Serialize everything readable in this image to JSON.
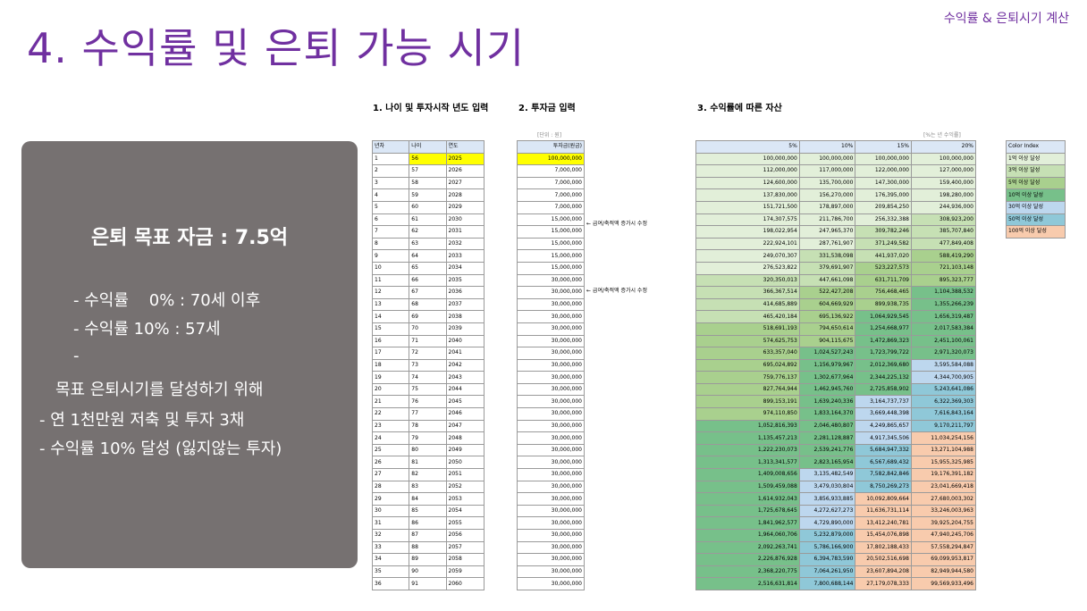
{
  "header": {
    "title": "4. 수익률 및 은퇴 가능 시기",
    "corner": "수익률 & 은퇴시기 계산"
  },
  "sections": {
    "s1": "1. 나이 및 투자시작 년도 입력",
    "s2": "2. 투자금 입력",
    "s3": "3. 수익률에 따른 자산"
  },
  "units": {
    "won": "[단위 : 원]",
    "rate": "[%는 년 수익률]"
  },
  "summary": {
    "goal": "은퇴 목표 자금 : 7.5억",
    "line1": "- 수익률    0% : 70세 이후",
    "line2": "- 수익률 10% : 57세",
    "line3": "-",
    "line4": "목표 은퇴시기를 달성하기 위해",
    "line5": "- 연 1천만원 저축 및 투자 3채",
    "line6": "- 수익률 10% 달성 (잃지않는 투자)"
  },
  "notes": {
    "n1": "← 급여/축적액 증가시 수정",
    "n2": "← 급여/축적액 증가시 수정"
  },
  "colors": {
    "accent": "#7030a0",
    "panel": "#767171",
    "start_highlight": "#ffff00",
    "tier1": "#e2efd9",
    "tier3": "#c6e0b4",
    "tier5": "#a9d08e",
    "tier10": "#77c08a",
    "tier30": "#bdd7ee",
    "tier50": "#8fc8d8",
    "tier100": "#f8cbad"
  },
  "table1": {
    "headers": [
      "년차",
      "나이",
      "연도"
    ],
    "rows": [
      [
        "1",
        "56",
        "2025"
      ],
      [
        "2",
        "57",
        "2026"
      ],
      [
        "3",
        "58",
        "2027"
      ],
      [
        "4",
        "59",
        "2028"
      ],
      [
        "5",
        "60",
        "2029"
      ],
      [
        "6",
        "61",
        "2030"
      ],
      [
        "7",
        "62",
        "2031"
      ],
      [
        "8",
        "63",
        "2032"
      ],
      [
        "9",
        "64",
        "2033"
      ],
      [
        "10",
        "65",
        "2034"
      ],
      [
        "11",
        "66",
        "2035"
      ],
      [
        "12",
        "67",
        "2036"
      ],
      [
        "13",
        "68",
        "2037"
      ],
      [
        "14",
        "69",
        "2038"
      ],
      [
        "15",
        "70",
        "2039"
      ],
      [
        "16",
        "71",
        "2040"
      ],
      [
        "17",
        "72",
        "2041"
      ],
      [
        "18",
        "73",
        "2042"
      ],
      [
        "19",
        "74",
        "2043"
      ],
      [
        "20",
        "75",
        "2044"
      ],
      [
        "21",
        "76",
        "2045"
      ],
      [
        "22",
        "77",
        "2046"
      ],
      [
        "23",
        "78",
        "2047"
      ],
      [
        "24",
        "79",
        "2048"
      ],
      [
        "25",
        "80",
        "2049"
      ],
      [
        "26",
        "81",
        "2050"
      ],
      [
        "27",
        "82",
        "2051"
      ],
      [
        "28",
        "83",
        "2052"
      ],
      [
        "29",
        "84",
        "2053"
      ],
      [
        "30",
        "85",
        "2054"
      ],
      [
        "31",
        "86",
        "2055"
      ],
      [
        "32",
        "87",
        "2056"
      ],
      [
        "33",
        "88",
        "2057"
      ],
      [
        "34",
        "89",
        "2058"
      ],
      [
        "35",
        "90",
        "2059"
      ],
      [
        "36",
        "91",
        "2060"
      ]
    ]
  },
  "table2": {
    "header": "투자금(원금)",
    "rows": [
      "100,000,000",
      "7,000,000",
      "7,000,000",
      "7,000,000",
      "7,000,000",
      "15,000,000",
      "15,000,000",
      "15,000,000",
      "15,000,000",
      "15,000,000",
      "30,000,000",
      "30,000,000",
      "30,000,000",
      "30,000,000",
      "30,000,000",
      "30,000,000",
      "30,000,000",
      "30,000,000",
      "30,000,000",
      "30,000,000",
      "30,000,000",
      "30,000,000",
      "30,000,000",
      "30,000,000",
      "30,000,000",
      "30,000,000",
      "30,000,000",
      "30,000,000",
      "30,000,000",
      "30,000,000",
      "30,000,000",
      "30,000,000",
      "30,000,000",
      "30,000,000",
      "30,000,000",
      "30,000,000"
    ]
  },
  "table3": {
    "headers": [
      "5%",
      "10%",
      "15%",
      "20%"
    ],
    "rows": [
      [
        "100,000,000",
        "100,000,000",
        "100,000,000",
        "100,000,000"
      ],
      [
        "112,000,000",
        "117,000,000",
        "122,000,000",
        "127,000,000"
      ],
      [
        "124,600,000",
        "135,700,000",
        "147,300,000",
        "159,400,000"
      ],
      [
        "137,830,000",
        "156,270,000",
        "176,395,000",
        "198,280,000"
      ],
      [
        "151,721,500",
        "178,897,000",
        "209,854,250",
        "244,936,000"
      ],
      [
        "174,307,575",
        "211,786,700",
        "256,332,388",
        "308,923,200"
      ],
      [
        "198,022,954",
        "247,965,370",
        "309,782,246",
        "385,707,840"
      ],
      [
        "222,924,101",
        "287,761,907",
        "371,249,582",
        "477,849,408"
      ],
      [
        "249,070,307",
        "331,538,098",
        "441,937,020",
        "588,419,290"
      ],
      [
        "276,523,822",
        "379,691,907",
        "523,227,573",
        "721,103,148"
      ],
      [
        "320,350,013",
        "447,661,098",
        "631,711,709",
        "895,323,777"
      ],
      [
        "366,367,514",
        "522,427,208",
        "756,468,465",
        "1,104,388,532"
      ],
      [
        "414,685,889",
        "604,669,929",
        "899,938,735",
        "1,355,266,239"
      ],
      [
        "465,420,184",
        "695,136,922",
        "1,064,929,545",
        "1,656,319,487"
      ],
      [
        "518,691,193",
        "794,650,614",
        "1,254,668,977",
        "2,017,583,384"
      ],
      [
        "574,625,753",
        "904,115,675",
        "1,472,869,323",
        "2,451,100,061"
      ],
      [
        "633,357,040",
        "1,024,527,243",
        "1,723,799,722",
        "2,971,320,073"
      ],
      [
        "695,024,892",
        "1,156,979,967",
        "2,012,369,680",
        "3,595,584,088"
      ],
      [
        "759,776,137",
        "1,302,677,964",
        "2,344,225,132",
        "4,344,700,905"
      ],
      [
        "827,764,944",
        "1,462,945,760",
        "2,725,858,902",
        "5,243,641,086"
      ],
      [
        "899,153,191",
        "1,639,240,336",
        "3,164,737,737",
        "6,322,369,303"
      ],
      [
        "974,110,850",
        "1,833,164,370",
        "3,669,448,398",
        "7,616,843,164"
      ],
      [
        "1,052,816,393",
        "2,046,480,807",
        "4,249,865,657",
        "9,170,211,797"
      ],
      [
        "1,135,457,213",
        "2,281,128,887",
        "4,917,345,506",
        "11,034,254,156"
      ],
      [
        "1,222,230,073",
        "2,539,241,776",
        "5,684,947,332",
        "13,271,104,988"
      ],
      [
        "1,313,341,577",
        "2,823,165,954",
        "6,567,689,432",
        "15,955,325,985"
      ],
      [
        "1,409,008,656",
        "3,135,482,549",
        "7,582,842,846",
        "19,176,391,182"
      ],
      [
        "1,509,459,088",
        "3,479,030,804",
        "8,750,269,273",
        "23,041,669,418"
      ],
      [
        "1,614,932,043",
        "3,856,933,885",
        "10,092,809,664",
        "27,680,003,302"
      ],
      [
        "1,725,678,645",
        "4,272,627,273",
        "11,636,731,114",
        "33,246,003,963"
      ],
      [
        "1,841,962,577",
        "4,729,890,000",
        "13,412,240,781",
        "39,925,204,755"
      ],
      [
        "1,964,060,706",
        "5,232,879,000",
        "15,454,076,898",
        "47,940,245,706"
      ],
      [
        "2,092,263,741",
        "5,786,166,900",
        "17,802,188,433",
        "57,558,294,847"
      ],
      [
        "2,226,876,928",
        "6,394,783,590",
        "20,502,516,698",
        "69,099,953,817"
      ],
      [
        "2,368,220,775",
        "7,064,261,950",
        "23,607,894,208",
        "82,949,944,580"
      ],
      [
        "2,516,631,814",
        "7,800,688,144",
        "27,179,078,333",
        "99,569,933,496"
      ]
    ]
  },
  "legend": {
    "header": "Color Index",
    "items": [
      "1억 이상 달성",
      "3억 이상 달성",
      "5억 이상 달성",
      "10억 이상 달성",
      "30억 이상 달성",
      "50억 이상 달성",
      "100억 이상 달성"
    ]
  }
}
